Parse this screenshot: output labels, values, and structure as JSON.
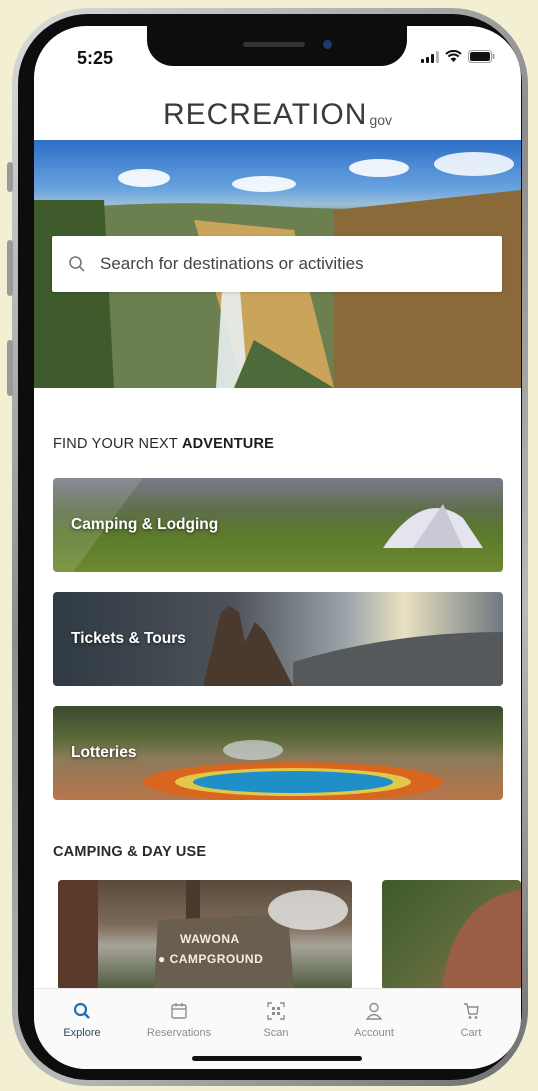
{
  "status": {
    "time": "5:25"
  },
  "logo": {
    "main": "RECREATION",
    "suffix": "gov"
  },
  "search": {
    "placeholder": "Search for destinations or activities"
  },
  "adventure": {
    "title_prefix": "FIND YOUR NEXT",
    "title_bold": "ADVENTURE",
    "cards": [
      {
        "label": "Camping & Lodging"
      },
      {
        "label": "Tickets & Tours"
      },
      {
        "label": "Lotteries"
      }
    ]
  },
  "camping": {
    "title": "CAMPING & DAY USE",
    "thumb_sign_line1": "WAWONA",
    "thumb_sign_line2": "CAMPGROUND"
  },
  "tabs": [
    {
      "label": "Explore",
      "icon": "search-icon"
    },
    {
      "label": "Reservations",
      "icon": "calendar-icon"
    },
    {
      "label": "Scan",
      "icon": "qr-scan-icon"
    },
    {
      "label": "Account",
      "icon": "user-icon"
    },
    {
      "label": "Cart",
      "icon": "cart-icon"
    }
  ],
  "colors": {
    "accent": "#2f4a5c",
    "explore_icon": "#1f6fb5",
    "inactive": "#8d8d8d"
  }
}
